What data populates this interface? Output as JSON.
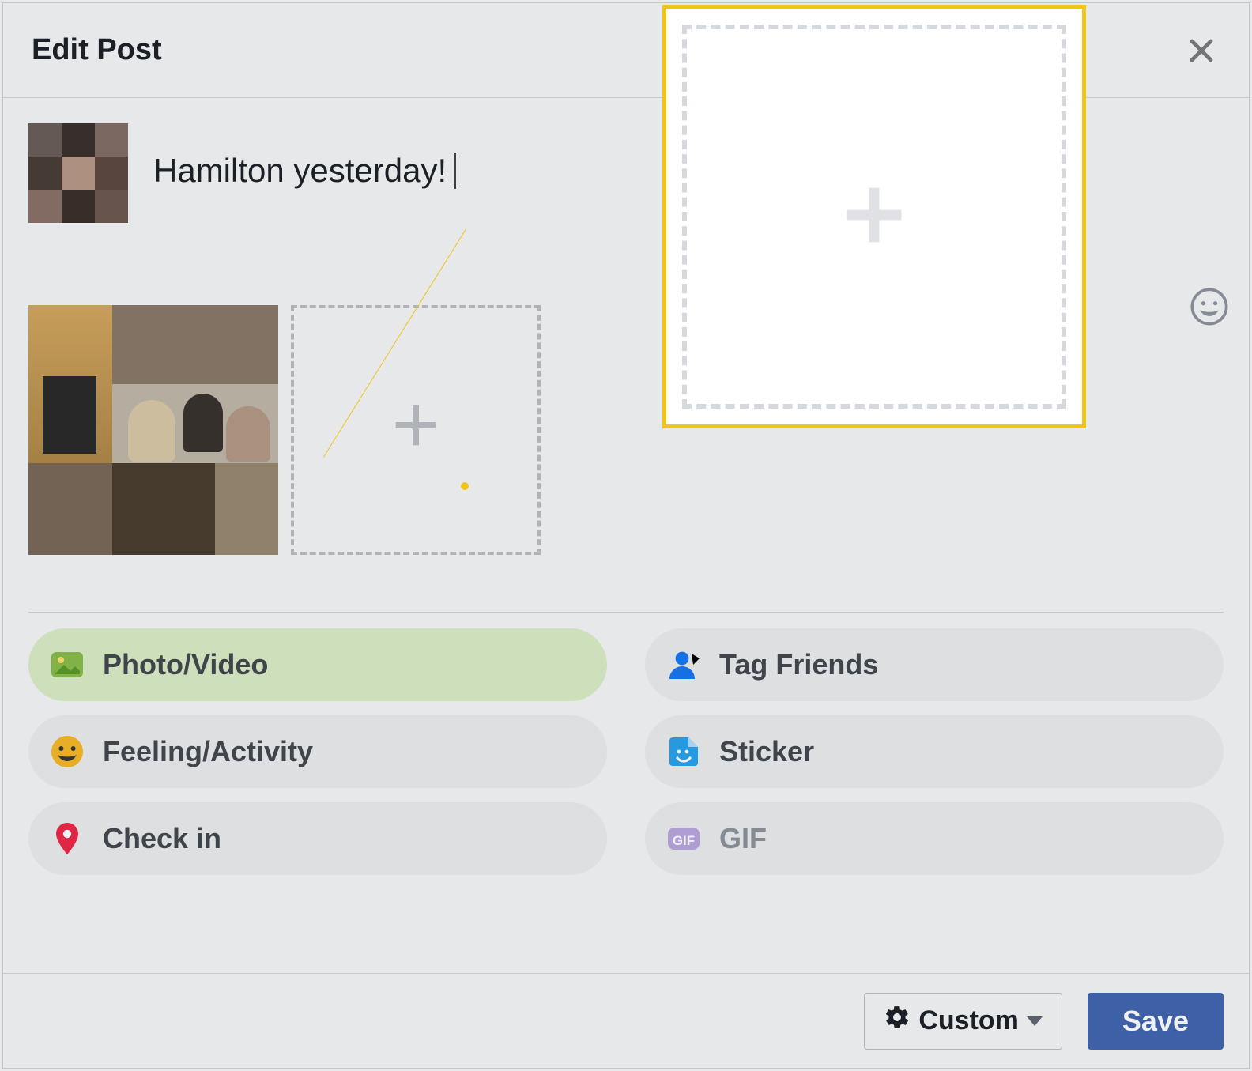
{
  "header": {
    "title": "Edit Post"
  },
  "post": {
    "text": "Hamilton yesterday!"
  },
  "actions": {
    "photo_video": "Photo/Video",
    "tag_friends": "Tag Friends",
    "feeling_activity": "Feeling/Activity",
    "sticker": "Sticker",
    "check_in": "Check in",
    "gif": "GIF"
  },
  "footer": {
    "privacy_label": "Custom",
    "save_label": "Save"
  }
}
